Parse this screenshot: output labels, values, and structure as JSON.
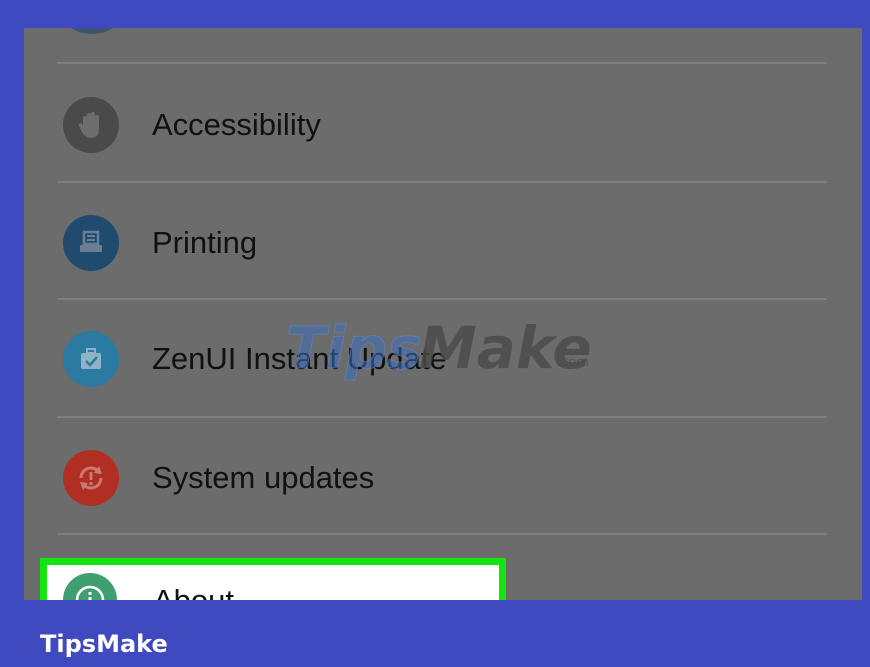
{
  "settings": {
    "items": [
      {
        "label": "Accessibility",
        "icon": "hand-icon",
        "color": "#4a4a4a"
      },
      {
        "label": "Printing",
        "icon": "printer-icon",
        "color": "#204a6e"
      },
      {
        "label": "ZenUI Instant Update",
        "icon": "briefcase-check-icon",
        "color": "#2b7aa1"
      },
      {
        "label": "System updates",
        "icon": "system-update-icon",
        "color": "#b12e23"
      }
    ],
    "highlighted_item": {
      "label": "About",
      "icon": "info-icon",
      "color": "#3f9f6f",
      "highlight_color": "#14e410"
    }
  },
  "watermark": {
    "text": "TipsMake",
    "suffix": ".com"
  },
  "footer": {
    "brand": "TipsMake"
  },
  "colors": {
    "frame": "#3f4ac0",
    "screen_overlay": "#6c6c6c"
  }
}
